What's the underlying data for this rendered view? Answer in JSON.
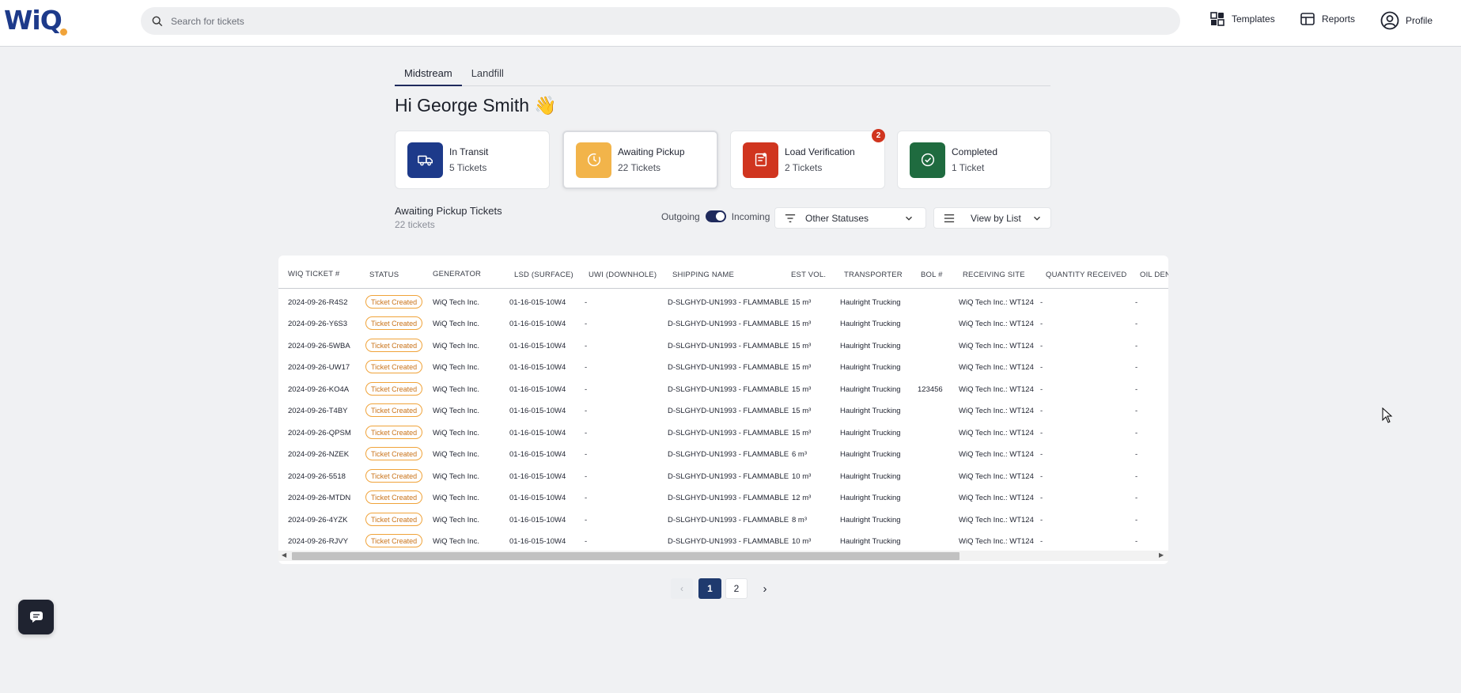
{
  "header": {
    "logo_text": "WiQ",
    "search_placeholder": "Search for tickets",
    "nav": [
      {
        "label": "Templates",
        "icon": "templates-icon"
      },
      {
        "label": "Reports",
        "icon": "reports-icon"
      },
      {
        "label": "Profile",
        "icon": "profile-icon"
      }
    ]
  },
  "tabs": [
    {
      "label": "Midstream",
      "active": true
    },
    {
      "label": "Landfill",
      "active": false
    }
  ],
  "greeting": "Hi George Smith 👋",
  "cards": [
    {
      "title": "In Transit",
      "sub": "5 Tickets",
      "color": "#1d3a8a",
      "icon": "truck-icon"
    },
    {
      "title": "Awaiting Pickup",
      "sub": "22 Tickets",
      "color": "#f2b44a",
      "icon": "clock-icon",
      "selected": true
    },
    {
      "title": "Load Verification",
      "sub": "2 Tickets",
      "color": "#d0351f",
      "icon": "verification-icon",
      "badge": "2"
    },
    {
      "title": "Completed",
      "sub": "1 Ticket",
      "color": "#1f6b3f",
      "icon": "check-circle-icon"
    }
  ],
  "section": {
    "title": "Awaiting Pickup Tickets",
    "sub": "22 tickets",
    "outgoing_label": "Outgoing",
    "incoming_label": "Incoming",
    "status_filter": "Other Statuses",
    "view_mode": "View by List"
  },
  "table": {
    "columns": [
      "WIQ TICKET #",
      "STATUS",
      "GENERATOR",
      "LSD (SURFACE)",
      "UWI (DOWNHOLE)",
      "SHIPPING NAME",
      "EST VOL.",
      "TRANSPORTER",
      "BOL #",
      "RECEIVING SITE",
      "QUANTITY RECEIVED",
      "OIL DEN"
    ],
    "rows": [
      [
        "2024-09-26-R4S2",
        "Ticket Created",
        "WiQ Tech Inc.",
        "01-16-015-10W4",
        "-",
        "D-SLGHYD-UN1993 - FLAMMABLE",
        "15 m³",
        "Haulright Trucking",
        "",
        "WiQ Tech Inc.: WT124",
        "-",
        "-"
      ],
      [
        "2024-09-26-Y6S3",
        "Ticket Created",
        "WiQ Tech Inc.",
        "01-16-015-10W4",
        "-",
        "D-SLGHYD-UN1993 - FLAMMABLE",
        "15 m³",
        "Haulright Trucking",
        "",
        "WiQ Tech Inc.: WT124",
        "-",
        "-"
      ],
      [
        "2024-09-26-5WBA",
        "Ticket Created",
        "WiQ Tech Inc.",
        "01-16-015-10W4",
        "-",
        "D-SLGHYD-UN1993 - FLAMMABLE",
        "15 m³",
        "Haulright Trucking",
        "",
        "WiQ Tech Inc.: WT124",
        "-",
        "-"
      ],
      [
        "2024-09-26-UW17",
        "Ticket Created",
        "WiQ Tech Inc.",
        "01-16-015-10W4",
        "-",
        "D-SLGHYD-UN1993 - FLAMMABLE",
        "15 m³",
        "Haulright Trucking",
        "",
        "WiQ Tech Inc.: WT124",
        "-",
        "-"
      ],
      [
        "2024-09-26-KO4A",
        "Ticket Created",
        "WiQ Tech Inc.",
        "01-16-015-10W4",
        "-",
        "D-SLGHYD-UN1993 - FLAMMABLE",
        "15 m³",
        "Haulright Trucking",
        "123456",
        "WiQ Tech Inc.: WT124",
        "-",
        "-"
      ],
      [
        "2024-09-26-T4BY",
        "Ticket Created",
        "WiQ Tech Inc.",
        "01-16-015-10W4",
        "-",
        "D-SLGHYD-UN1993 - FLAMMABLE",
        "15 m³",
        "Haulright Trucking",
        "",
        "WiQ Tech Inc.: WT124",
        "-",
        "-"
      ],
      [
        "2024-09-26-QPSM",
        "Ticket Created",
        "WiQ Tech Inc.",
        "01-16-015-10W4",
        "-",
        "D-SLGHYD-UN1993 - FLAMMABLE",
        "15 m³",
        "Haulright Trucking",
        "",
        "WiQ Tech Inc.: WT124",
        "-",
        "-"
      ],
      [
        "2024-09-26-NZEK",
        "Ticket Created",
        "WiQ Tech Inc.",
        "01-16-015-10W4",
        "-",
        "D-SLGHYD-UN1993 - FLAMMABLE",
        "6 m³",
        "Haulright Trucking",
        "",
        "WiQ Tech Inc.: WT124",
        "-",
        "-"
      ],
      [
        "2024-09-26-5518",
        "Ticket Created",
        "WiQ Tech Inc.",
        "01-16-015-10W4",
        "-",
        "D-SLGHYD-UN1993 - FLAMMABLE",
        "10 m³",
        "Haulright Trucking",
        "",
        "WiQ Tech Inc.: WT124",
        "-",
        "-"
      ],
      [
        "2024-09-26-MTDN",
        "Ticket Created",
        "WiQ Tech Inc.",
        "01-16-015-10W4",
        "-",
        "D-SLGHYD-UN1993 - FLAMMABLE",
        "12 m³",
        "Haulright Trucking",
        "",
        "WiQ Tech Inc.: WT124",
        "-",
        "-"
      ],
      [
        "2024-09-26-4YZK",
        "Ticket Created",
        "WiQ Tech Inc.",
        "01-16-015-10W4",
        "-",
        "D-SLGHYD-UN1993 - FLAMMABLE",
        "8 m³",
        "Haulright Trucking",
        "",
        "WiQ Tech Inc.: WT124",
        "-",
        "-"
      ],
      [
        "2024-09-26-RJVY",
        "Ticket Created",
        "WiQ Tech Inc.",
        "01-16-015-10W4",
        "-",
        "D-SLGHYD-UN1993 - FLAMMABLE",
        "10 m³",
        "Haulright Trucking",
        "",
        "WiQ Tech Inc.: WT124",
        "-",
        "-"
      ]
    ]
  },
  "pagination": {
    "prev": "‹",
    "pages": [
      "1",
      "2"
    ],
    "current": "1",
    "next": "›"
  },
  "colors": {
    "brand": "#1d3a8a",
    "accent_orange": "#f0a33a",
    "active_page": "#1f3a6e"
  }
}
